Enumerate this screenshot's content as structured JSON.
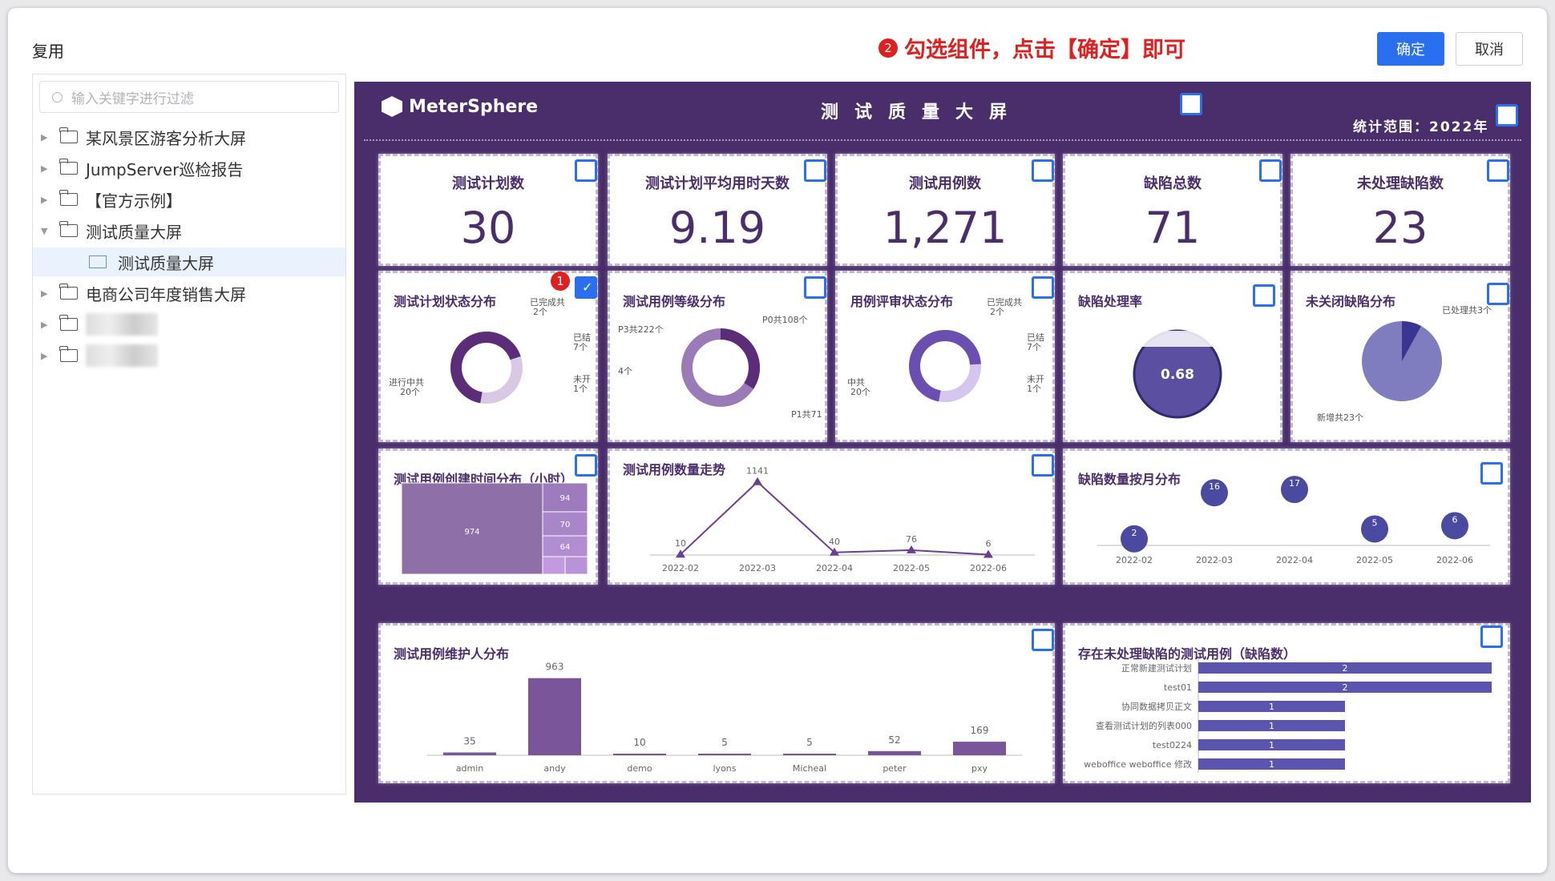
{
  "dialog": {
    "title": "复用",
    "hint": "勾选组件，点击【确定】即可",
    "hint_badge": "2",
    "confirm": "确定",
    "cancel": "取消"
  },
  "tree": {
    "search_placeholder": "输入关键字进行过滤",
    "items": [
      {
        "label": "某风景区游客分析大屏"
      },
      {
        "label": "JumpServer巡检报告"
      },
      {
        "label": "【官方示例】"
      },
      {
        "label": "测试质量大屏"
      },
      {
        "label": "测试质量大屏"
      },
      {
        "label": "电商公司年度销售大屏"
      }
    ]
  },
  "dashboard": {
    "logo": "MeterSphere",
    "title": "测试质量大屏",
    "range": "统计范围：2022年",
    "kpis": [
      {
        "title": "测试计划数",
        "value": "30"
      },
      {
        "title": "测试计划平均用时天数",
        "value": "9.19"
      },
      {
        "title": "测试用例数",
        "value": "1,271"
      },
      {
        "title": "缺陷总数",
        "value": "71"
      },
      {
        "title": "未处理缺陷数",
        "value": "23"
      }
    ],
    "charts": {
      "plan_status": {
        "title": "测试计划状态分布",
        "badge": "1",
        "labels": [
          "已完成共",
          "2个",
          "已结",
          "7个",
          "未开",
          "1个",
          "进行中共",
          "20个"
        ]
      },
      "case_level": {
        "title": "测试用例等级分布",
        "labels": [
          "P0共108个",
          "P3共222个",
          "4个",
          "P1共71"
        ]
      },
      "review_status": {
        "title": "用例评审状态分布",
        "labels": [
          "已完成共",
          "2个",
          "已结",
          "7个",
          "未开",
          "1个",
          "中共",
          "20个"
        ]
      },
      "bug_rate": {
        "title": "缺陷处理率",
        "value": "0.68"
      },
      "open_bugs": {
        "title": "未关闭缺陷分布",
        "labels": [
          "已处理共3个",
          "新增共23个"
        ]
      },
      "create_time": {
        "title": "测试用例创建时间分布（小时）",
        "cells": [
          "974",
          "94",
          "70",
          "64"
        ]
      },
      "case_trend": {
        "title": "测试用例数量走势"
      },
      "bug_month": {
        "title": "缺陷数量按月分布"
      },
      "maintainer": {
        "title": "测试用例维护人分布"
      },
      "unresolved": {
        "title": "存在未处理缺陷的测试用例（缺陷数）"
      }
    }
  },
  "chart_data": [
    {
      "type": "line",
      "title": "测试用例数量走势",
      "x": [
        "2022-02",
        "2022-03",
        "2022-04",
        "2022-05",
        "2022-06"
      ],
      "values": [
        10,
        1141,
        40,
        76,
        6
      ],
      "ylim": [
        0,
        1200
      ]
    },
    {
      "type": "scatter",
      "title": "缺陷数量按月分布",
      "x": [
        "2022-02",
        "2022-03",
        "2022-04",
        "2022-05",
        "2022-06"
      ],
      "values": [
        2,
        16,
        17,
        5,
        6
      ]
    },
    {
      "type": "bar",
      "title": "测试用例维护人分布",
      "categories": [
        "admin",
        "andy",
        "demo",
        "lyons",
        "Micheal",
        "peter",
        "pxy"
      ],
      "values": [
        35,
        963,
        10,
        5,
        5,
        52,
        169
      ],
      "ylim": [
        0,
        1000
      ]
    },
    {
      "type": "bar",
      "title": "存在未处理缺陷的测试用例（缺陷数）",
      "categories": [
        "正常新建测试计划",
        "test01",
        "协同数据拷贝正文",
        "查看测试计划的列表000",
        "test0224",
        "weboffice weboffice 修改"
      ],
      "values": [
        2,
        2,
        1,
        1,
        1,
        1
      ],
      "xlim": [
        0,
        2
      ]
    }
  ]
}
